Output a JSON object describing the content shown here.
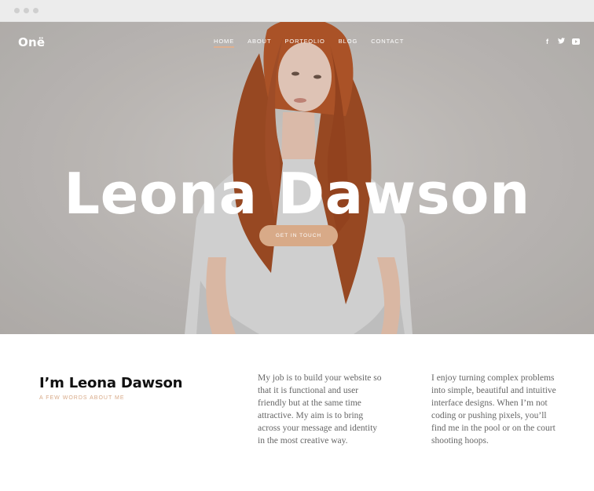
{
  "browser": {
    "dots": 3
  },
  "header": {
    "logo": "Onë",
    "nav": [
      {
        "label": "HOME",
        "active": true
      },
      {
        "label": "ABOUT",
        "active": false
      },
      {
        "label": "PORTFOLIO",
        "active": false
      },
      {
        "label": "BLOG",
        "active": false
      },
      {
        "label": "CONTACT",
        "active": false
      }
    ],
    "social": [
      {
        "icon": "facebook-icon",
        "glyph": "f"
      },
      {
        "icon": "twitter-icon",
        "glyph": ""
      },
      {
        "icon": "youtube-icon",
        "glyph": ""
      }
    ]
  },
  "hero": {
    "title": "Leona Dawson",
    "cta_label": "GET IN TOUCH"
  },
  "about": {
    "heading": "I’m Leona Dawson",
    "subheading": "A FEW WORDS ABOUT ME",
    "paragraph1": "My job is to build your website so that it is functional and user friendly but at the same time attractive. My aim is to bring across your message and identity in the most creative way.",
    "paragraph2": "I enjoy turning complex problems into simple, beautiful and intuitive interface designs. When I’m not coding or pushing pixels, you’ll find me in the pool or on the court shooting hoops."
  },
  "colors": {
    "accent": "#d8aa88",
    "hero_bg": "#c6c2bf",
    "text_dark": "#111111",
    "text_body": "#666666"
  }
}
